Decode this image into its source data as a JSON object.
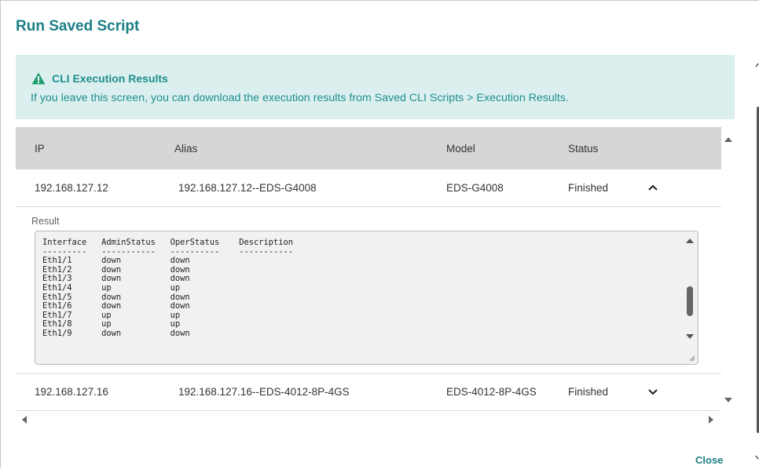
{
  "dialog": {
    "title": "Run Saved Script",
    "banner": {
      "heading": "CLI Execution Results",
      "text": "If you leave this screen, you can download the execution results from Saved CLI Scripts > Execution Results.",
      "icon": "warning-icon"
    },
    "table": {
      "columns": [
        "IP",
        "Alias",
        "Model",
        "Status"
      ],
      "rows": [
        {
          "ip": "192.168.127.12",
          "alias": "192.168.127.12--EDS-G4008",
          "model": "EDS-G4008",
          "status": "Finished",
          "expanded": true
        },
        {
          "ip": "192.168.127.16",
          "alias": "192.168.127.16--EDS-4012-8P-4GS",
          "model": "EDS-4012-8P-4GS",
          "status": "Finished",
          "expanded": false
        }
      ],
      "result_label": "Result",
      "result_text": "Interface   AdminStatus   OperStatus    Description\n---------   -----------   ----------    -----------\nEth1/1      down          down\nEth1/2      down          down\nEth1/3      down          down\nEth1/4      up            up\nEth1/5      down          down\nEth1/6      down          down\nEth1/7      up            up\nEth1/8      up            up\nEth1/9      down          down"
    },
    "close_label": "Close"
  },
  "colors": {
    "accent": "#1a7f86",
    "banner_bg": "#dcefef",
    "header_bg": "#d6d6d6"
  }
}
